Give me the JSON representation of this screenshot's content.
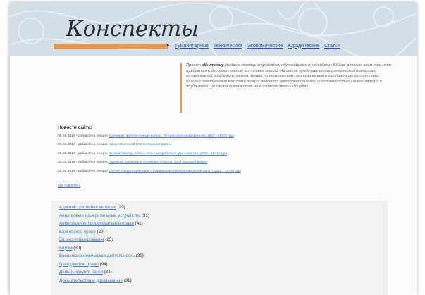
{
  "header": {
    "logo": "Конспекты",
    "nav": [
      "Гуманитарные",
      "Технические",
      "Экономические",
      "Юридические",
      "Статьи"
    ]
  },
  "intro": {
    "before": "Проект ",
    "brand": "allsummary",
    "after": " создан в помощь студентам, обучающимся в российских ВУЗах, а также всем тем, кто нуждается в дополнительном источнике знаний. На сайте представлен теоретический материал, оформленный в виде конспектов лекций по техническим, экономическим и юридическим дисциплинам. Каждый электронный конспект лекций является интеллектуальной собственностью своего автора и опубликован на сайте исключительно в ознакомительных целях."
  },
  "news": {
    "title": "Новости сайта:",
    "items": [
      {
        "prefix": "06.06.2014 - добавлена лекция",
        "link": "Коренной перелом в ходе войны. Тегеранская конференция. 1942 - 1943 годы"
      },
      {
        "prefix": "06.06.2014 - добавлена лекция",
        "link": "Начало Великой Отечественной войны"
      },
      {
        "prefix": "06.06.2014 - добавлена лекция",
        "link": "Первый период войны. Военные действия. Дипломатия. 1939 - 1941 годы"
      },
      {
        "prefix": "06.06.2014 - добавлена лекция",
        "link": "Причины, характер и основные этапы Второй мировой войны"
      },
      {
        "prefix": "06.06.2014 - добавлена лекция",
        "link": "Третий этап интервенции. Гражданская война и народный фронт 1926 - 1939 годы"
      }
    ],
    "all_link": "все новости »"
  },
  "categories": [
    {
      "name": "Административная юстиция",
      "count": "(29)"
    },
    {
      "name": "Аналоговые измерительные устройства",
      "count": "(31)"
    },
    {
      "name": "Арбитражное процессуальное право",
      "count": "(41)"
    },
    {
      "name": "Банковское право",
      "count": "(29)"
    },
    {
      "name": "Бизнес-планирование",
      "count": "(25)"
    },
    {
      "name": "Биржи",
      "count": "(30)"
    },
    {
      "name": "Внешнеэкономическая деятельность",
      "count": "(39)"
    },
    {
      "name": "Гражданское право",
      "count": "(94)"
    },
    {
      "name": "Деньги, кредит, банки",
      "count": "(34)"
    },
    {
      "name": "Доказательства и доказывание",
      "count": "(31)"
    }
  ],
  "colors": {
    "header_bg": "#d3dee7",
    "accent": "#e39a52",
    "link": "#4f7fb2"
  }
}
